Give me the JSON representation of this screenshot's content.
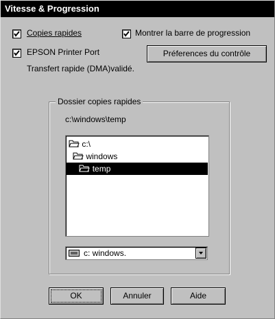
{
  "window": {
    "title": "Vitesse & Progression"
  },
  "options": {
    "fast_copies": {
      "label": "Copies rapides",
      "checked": true
    },
    "show_progress": {
      "label": "Montrer la barre de progression",
      "checked": true
    },
    "epson_port": {
      "label": "EPSON Printer Port",
      "checked": true
    },
    "monitor_prefs_label": "Préferences du contrôle",
    "transfer_status": "Transfert rapide (DMA)validé."
  },
  "fast_copy_folder": {
    "group_title": "Dossier copies rapides",
    "path": "c:\\windows\\temp",
    "tree": [
      {
        "label": "c:\\",
        "level": 0,
        "selected": false,
        "icon": "folder-open-icon"
      },
      {
        "label": "windows",
        "level": 1,
        "selected": false,
        "icon": "folder-open-icon"
      },
      {
        "label": "temp",
        "level": 2,
        "selected": true,
        "icon": "folder-open-icon"
      }
    ],
    "drive": {
      "value": "c:  windows.",
      "icon": "drive-icon"
    }
  },
  "buttons": {
    "ok": "OK",
    "cancel": "Annuler",
    "help": "Aide"
  }
}
